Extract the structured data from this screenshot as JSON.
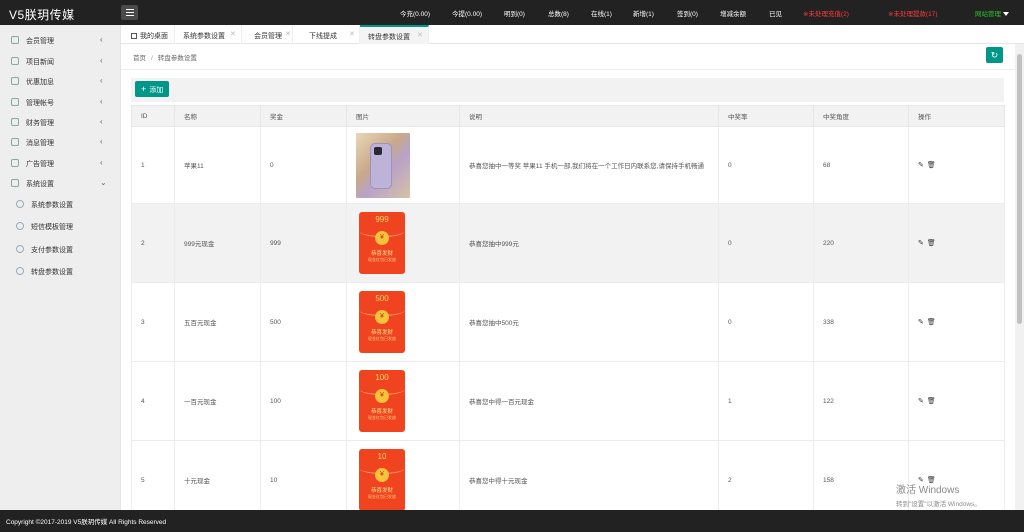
{
  "brand": "V5朕玥传媒",
  "header_stats": [
    {
      "label": "今充(0.00)",
      "color": "white"
    },
    {
      "label": "今提(0.00)",
      "color": "white"
    },
    {
      "label": "明到(0)",
      "color": "white"
    },
    {
      "label": "总数(8)",
      "color": "white"
    },
    {
      "label": "在线(1)",
      "color": "white"
    },
    {
      "label": "新增(1)",
      "color": "white"
    },
    {
      "label": "签到(0)",
      "color": "white"
    },
    {
      "label": "增减余额",
      "color": "white"
    },
    {
      "label": "已见",
      "color": "white"
    },
    {
      "label": "※未处理充值(2)",
      "color": "red"
    },
    {
      "label": "※未处理提款(17)",
      "color": "red"
    },
    {
      "label": "网站管理",
      "color": "green"
    }
  ],
  "sidebar": {
    "items": [
      {
        "label": "会员管理",
        "arrow": "‹"
      },
      {
        "label": "项目新闻",
        "arrow": "‹"
      },
      {
        "label": "优惠加息",
        "arrow": "‹"
      },
      {
        "label": "管理帐号",
        "arrow": "‹"
      },
      {
        "label": "财务管理",
        "arrow": "‹"
      },
      {
        "label": "消息管理",
        "arrow": "‹"
      },
      {
        "label": "广告管理",
        "arrow": "‹"
      },
      {
        "label": "系统设置",
        "arrow": "⌄"
      }
    ],
    "subitems": [
      {
        "label": "系统参数设置"
      },
      {
        "label": "短信模板管理"
      },
      {
        "label": "支付参数设置"
      },
      {
        "label": "转盘参数设置"
      }
    ]
  },
  "tabs": [
    {
      "label": "我的桌面"
    },
    {
      "label": "系统参数设置"
    },
    {
      "label": "会员管理"
    },
    {
      "label": "下线提成"
    },
    {
      "label": "转盘参数设置"
    }
  ],
  "breadcrumb": {
    "home": "首页",
    "separator": "/",
    "current": "转盘参数设置"
  },
  "add_button": "添加",
  "table": {
    "headers": [
      "ID",
      "名称",
      "奖金",
      "图片",
      "说明",
      "中奖率",
      "中奖角度",
      "操作"
    ],
    "rows": [
      {
        "id": "1",
        "name": "苹果11",
        "bonus": "0",
        "image": "phone",
        "desc": "恭喜您抽中一等奖 苹果11 手机一部,我们将在一个工作日内联系您,请保持手机畅通",
        "rate": "0",
        "angle": "68"
      },
      {
        "id": "2",
        "name": "999元现金",
        "bonus": "999",
        "image": "redpacket",
        "img_num": "999",
        "desc": "恭喜您抽中999元",
        "rate": "0",
        "angle": "220"
      },
      {
        "id": "3",
        "name": "五百元现金",
        "bonus": "500",
        "image": "redpacket",
        "img_num": "500",
        "desc": "恭喜您抽中500元",
        "rate": "0",
        "angle": "338"
      },
      {
        "id": "4",
        "name": "一百元现金",
        "bonus": "100",
        "image": "redpacket",
        "img_num": "100",
        "desc": "恭喜您中得一百元现金",
        "rate": "1",
        "angle": "122"
      },
      {
        "id": "5",
        "name": "十元现金",
        "bonus": "10",
        "image": "redpacket",
        "img_num": "10",
        "desc": "恭喜您中得十元现金",
        "rate": "2",
        "angle": "158"
      }
    ],
    "ops": {
      "edit": "✎",
      "delete": "🗑"
    }
  },
  "redpacket_text": {
    "line1": "恭喜发财",
    "line2": "现金红包已发放"
  },
  "coin_symbol": "¥",
  "footer": "Copyright ©2017-2019 V5朕玥传媒 All Rights Reserved",
  "watermark": {
    "line1": "激活 Windows",
    "line2": "转到\"设置\"以激活 Windows。"
  },
  "colors": {
    "accent": "#009688",
    "topbar": "#222222",
    "alert": "#ff3b3b",
    "ok": "#2ec22e"
  }
}
